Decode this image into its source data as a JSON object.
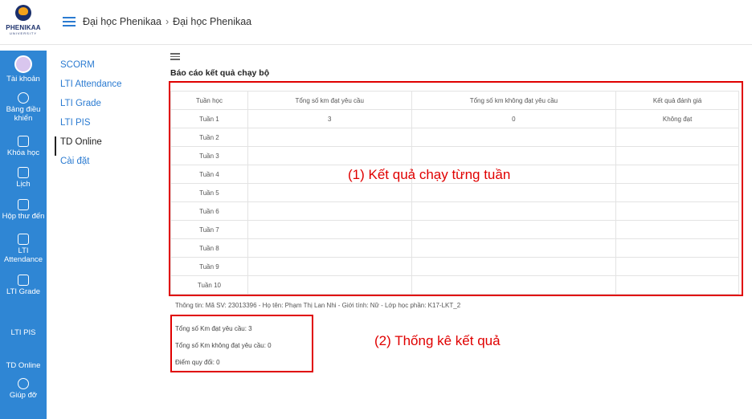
{
  "header": {
    "logo_text": "PHENIKAA",
    "logo_sub": "UNIVERSITY",
    "breadcrumb": [
      "Đại học Phenikaa",
      "Đại học Phenikaa"
    ]
  },
  "sidebar": {
    "items": [
      {
        "label": "Tài khoản",
        "icon": "user-avatar-icon"
      },
      {
        "label": "Bảng điều khiển",
        "icon": "dashboard-icon"
      },
      {
        "label": "Khóa học",
        "icon": "course-icon"
      },
      {
        "label": "Lịch",
        "icon": "calendar-icon"
      },
      {
        "label": "Hộp thư đến",
        "icon": "inbox-icon"
      },
      {
        "label": "LTI Attendance",
        "icon": "document-icon"
      },
      {
        "label": "LTI Grade",
        "icon": "grade-icon"
      },
      {
        "label": "LTI PIS",
        "icon": ""
      },
      {
        "label": "TD Online",
        "icon": ""
      },
      {
        "label": "Giúp đỡ",
        "icon": "help-icon"
      }
    ]
  },
  "submenu": {
    "items": [
      "SCORM",
      "LTI Attendance",
      "LTI Grade",
      "LTI PIS",
      "TD Online",
      "Cài đặt"
    ],
    "active_index": 4
  },
  "report": {
    "title": "Báo cáo kết quả chạy bộ",
    "columns": [
      "Tuần học",
      "Tổng số km đạt yêu cầu",
      "Tổng số km không đạt yêu cầu",
      "Kết quả đánh giá"
    ],
    "rows": [
      [
        "Tuần 1",
        "3",
        "0",
        "Không đạt"
      ],
      [
        "Tuần 2",
        "",
        "",
        ""
      ],
      [
        "Tuần 3",
        "",
        "",
        ""
      ],
      [
        "Tuần 4",
        "",
        "",
        ""
      ],
      [
        "Tuần 5",
        "",
        "",
        ""
      ],
      [
        "Tuần 6",
        "",
        "",
        ""
      ],
      [
        "Tuần 7",
        "",
        "",
        ""
      ],
      [
        "Tuần 8",
        "",
        "",
        ""
      ],
      [
        "Tuần 9",
        "",
        "",
        ""
      ],
      [
        "Tuần 10",
        "",
        "",
        ""
      ]
    ],
    "info": "Thông tin: Mã SV: 23013396 - Họ tên: Phạm Thị Lan Nhi - Giới tính: Nữ - Lớp học phần: K17-LKT_2",
    "stats": [
      "Tổng số Km đạt yêu cầu: 3",
      "Tổng số Km không đạt yêu cầu: 0",
      "Điểm quy đổi: 0"
    ]
  },
  "annotations": {
    "weekly": "(1) Kết quả chạy từng tuần",
    "summary": "(2) Thống kê kết quả"
  },
  "colors": {
    "accent": "#2f86d4",
    "link": "#2b7bd1",
    "annotation": "#e00000"
  }
}
